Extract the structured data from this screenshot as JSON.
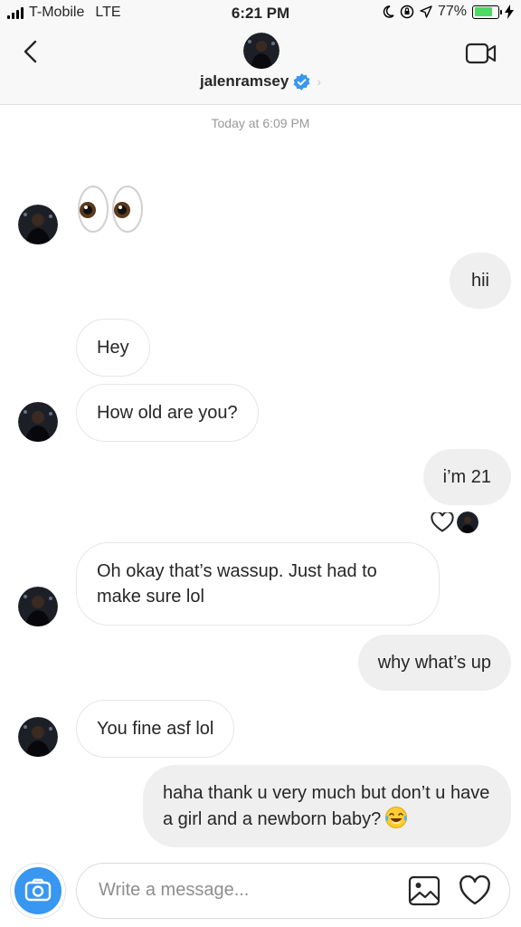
{
  "status_bar": {
    "carrier": "T-Mobile",
    "network": "LTE",
    "time": "6:21 PM",
    "battery": "77%",
    "battery_level": 0.77,
    "battery_color": "#4cd964"
  },
  "header": {
    "username": "jalenramsey",
    "verified": true,
    "back_icon": "chevron-left-icon",
    "video_icon": "video-camera-icon"
  },
  "thread": {
    "timestamp": "Today at 6:09 PM",
    "messages": [
      {
        "from": "them",
        "type": "emoji",
        "emoji": "👀"
      },
      {
        "from": "me",
        "text": "hii"
      },
      {
        "from": "them",
        "text": "Hey"
      },
      {
        "from": "them",
        "text": "How old are you?"
      },
      {
        "from": "me",
        "text": "i’m 21",
        "reaction": "heart-outline-icon"
      },
      {
        "from": "them",
        "text": "Oh okay that’s wassup. Just had to make sure lol"
      },
      {
        "from": "me",
        "text": "why what’s up"
      },
      {
        "from": "them",
        "text": "You fine asf lol"
      },
      {
        "from": "me",
        "text": "haha thank u very much but don’t u have a girl and a newborn baby?",
        "emoji": "😂"
      }
    ]
  },
  "composer": {
    "placeholder": "Write a message...",
    "camera_icon": "camera-icon",
    "gallery_icon": "image-icon",
    "heart_icon": "heart-icon",
    "accent": "#3897f0"
  }
}
